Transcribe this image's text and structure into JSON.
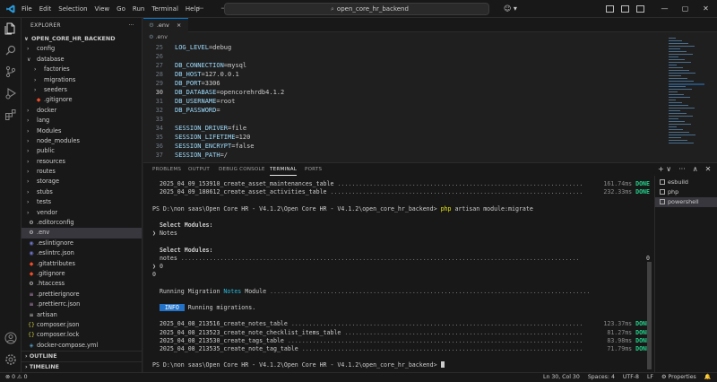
{
  "menu": [
    "File",
    "Edit",
    "Selection",
    "View",
    "Go",
    "Run",
    "Terminal",
    "Help"
  ],
  "title": {
    "nav_arrows": "← →",
    "search": "open_core_hr_backend",
    "search_icon": "search-icon"
  },
  "window_controls": [
    "—",
    "▢",
    "✕"
  ],
  "sidebar": {
    "header": "EXPLORER",
    "header_more": "···",
    "project": "OPEN_CORE_HR_BACKEND",
    "items": [
      {
        "label": "config",
        "type": "folder",
        "depth": 1,
        "expanded": false
      },
      {
        "label": "database",
        "type": "folder",
        "depth": 1,
        "expanded": true
      },
      {
        "label": "factories",
        "type": "folder",
        "depth": 2,
        "expanded": false
      },
      {
        "label": "migrations",
        "type": "folder",
        "depth": 2,
        "expanded": false
      },
      {
        "label": "seeders",
        "type": "folder",
        "depth": 2,
        "expanded": false
      },
      {
        "label": ".gitignore",
        "type": "file",
        "depth": 2,
        "icon": "◆",
        "color": "#f14c28"
      },
      {
        "label": "docker",
        "type": "folder",
        "depth": 1,
        "expanded": false
      },
      {
        "label": "lang",
        "type": "folder",
        "depth": 1,
        "expanded": false
      },
      {
        "label": "Modules",
        "type": "folder",
        "depth": 1,
        "expanded": false
      },
      {
        "label": "node_modules",
        "type": "folder",
        "depth": 1,
        "expanded": false
      },
      {
        "label": "public",
        "type": "folder",
        "depth": 1,
        "expanded": false
      },
      {
        "label": "resources",
        "type": "folder",
        "depth": 1,
        "expanded": false
      },
      {
        "label": "routes",
        "type": "folder",
        "depth": 1,
        "expanded": false
      },
      {
        "label": "storage",
        "type": "folder",
        "depth": 1,
        "expanded": false
      },
      {
        "label": "stubs",
        "type": "folder",
        "depth": 1,
        "expanded": false
      },
      {
        "label": "tests",
        "type": "folder",
        "depth": 1,
        "expanded": false
      },
      {
        "label": "vendor",
        "type": "folder",
        "depth": 1,
        "expanded": false
      },
      {
        "label": ".editorconfig",
        "type": "file",
        "depth": 1,
        "icon": "⚙",
        "color": "#cccccc"
      },
      {
        "label": ".env",
        "type": "file",
        "depth": 1,
        "icon": "⚙",
        "color": "#cccccc",
        "selected": true
      },
      {
        "label": ".eslintignore",
        "type": "file",
        "depth": 1,
        "icon": "◉",
        "color": "#6c71c4"
      },
      {
        "label": ".eslintrc.json",
        "type": "file",
        "depth": 1,
        "icon": "◉",
        "color": "#6c71c4"
      },
      {
        "label": ".gitattributes",
        "type": "file",
        "depth": 1,
        "icon": "◆",
        "color": "#f14c28"
      },
      {
        "label": ".gitignore",
        "type": "file",
        "depth": 1,
        "icon": "◆",
        "color": "#f14c28"
      },
      {
        "label": ".htaccess",
        "type": "file",
        "depth": 1,
        "icon": "⚙",
        "color": "#cccccc"
      },
      {
        "label": ".prettierignore",
        "type": "file",
        "depth": 1,
        "icon": "≡",
        "color": "#c596c7"
      },
      {
        "label": ".prettierrc.json",
        "type": "file",
        "depth": 1,
        "icon": "≡",
        "color": "#c596c7"
      },
      {
        "label": "artisan",
        "type": "file",
        "depth": 1,
        "icon": "≡",
        "color": "#cccccc"
      },
      {
        "label": "composer.json",
        "type": "file",
        "depth": 1,
        "icon": "{}",
        "color": "#cbcb41"
      },
      {
        "label": "composer.lock",
        "type": "file",
        "depth": 1,
        "icon": "{}",
        "color": "#cbcb41"
      },
      {
        "label": "docker-compose.yml",
        "type": "file",
        "depth": 1,
        "icon": "◈",
        "color": "#519aba"
      }
    ],
    "outline": "OUTLINE",
    "timeline": "TIMELINE"
  },
  "editor": {
    "tab_label": ".env",
    "tab_close": "×",
    "breadcrumb": ".env",
    "active_line": 30,
    "lines": [
      {
        "n": "25",
        "key": "LOG_LEVEL",
        "val": "debug"
      },
      {
        "n": "26",
        "key": "",
        "val": ""
      },
      {
        "n": "27",
        "key": "DB_CONNECTION",
        "val": "mysql"
      },
      {
        "n": "28",
        "key": "DB_HOST",
        "val": "127.0.0.1"
      },
      {
        "n": "29",
        "key": "DB_PORT",
        "val": "3306"
      },
      {
        "n": "30",
        "key": "DB_DATABASE",
        "val": "opencorehrdb4.1.2"
      },
      {
        "n": "31",
        "key": "DB_USERNAME",
        "val": "root"
      },
      {
        "n": "32",
        "key": "DB_PASSWORD",
        "val": ""
      },
      {
        "n": "33",
        "key": "",
        "val": ""
      },
      {
        "n": "34",
        "key": "SESSION_DRIVER",
        "val": "file"
      },
      {
        "n": "35",
        "key": "SESSION_LIFETIME",
        "val": "120"
      },
      {
        "n": "36",
        "key": "SESSION_ENCRYPT",
        "val": "false"
      },
      {
        "n": "37",
        "key": "SESSION_PATH",
        "val": "/"
      }
    ]
  },
  "panel": {
    "tabs": [
      "PROBLEMS",
      "OUTPUT",
      "DEBUG CONSOLE",
      "TERMINAL",
      "PORTS"
    ],
    "active_tab": "TERMINAL",
    "actions": [
      "+ ∨",
      "···",
      "∧",
      "✕"
    ],
    "terminals": [
      {
        "name": "esbuild",
        "active": false
      },
      {
        "name": "php",
        "active": false
      },
      {
        "name": "powershell",
        "active": true
      }
    ],
    "lines": [
      {
        "kind": "migr",
        "name": "2025_04_09_153910_create_asset_maintenances_table",
        "time": "161.74ms",
        "status": "DONE"
      },
      {
        "kind": "migr",
        "name": "2025_04_09_180612_create_asset_activities_table",
        "time": "232.33ms",
        "status": "DONE"
      },
      {
        "kind": "blank"
      },
      {
        "kind": "prompt",
        "prompt": "PS D:\\non saas\\Open Core HR - V4.1.2\\Open Core HR - V4.1.2\\open_core_hr_backend>",
        "cmd": "php",
        "args": " artisan module:migrate"
      },
      {
        "kind": "blank"
      },
      {
        "kind": "bold",
        "text": "  Select Modules:"
      },
      {
        "kind": "text",
        "text": "❯ Notes"
      },
      {
        "kind": "blank"
      },
      {
        "kind": "bold",
        "text": "  Select Modules:"
      },
      {
        "kind": "progress",
        "text": "  notes",
        "right": "0"
      },
      {
        "kind": "text",
        "text": "❯ 0"
      },
      {
        "kind": "text",
        "text": "0"
      },
      {
        "kind": "blank"
      },
      {
        "kind": "running",
        "pre": "  Running Migration ",
        "mod": "Notes",
        "post": " Module"
      },
      {
        "kind": "blank"
      },
      {
        "kind": "info",
        "badge": "INFO",
        "text": " Running migrations."
      },
      {
        "kind": "blank"
      },
      {
        "kind": "migr",
        "name": "2025_04_08_213516_create_notes_table",
        "time": "123.37ms",
        "status": "DONE"
      },
      {
        "kind": "migr",
        "name": "2025_04_08_213523_create_note_checklist_items_table",
        "time": "81.27ms",
        "status": "DONE"
      },
      {
        "kind": "migr",
        "name": "2025_04_08_213530_create_tags_table",
        "time": "83.98ms",
        "status": "DONE"
      },
      {
        "kind": "migr",
        "name": "2025_04_08_213535_create_note_tag_table",
        "time": "71.79ms",
        "status": "DONE"
      },
      {
        "kind": "blank"
      },
      {
        "kind": "prompt_cursor",
        "prompt": "PS D:\\non saas\\Open Core HR - V4.1.2\\Open Core HR - V4.1.2\\open_core_hr_backend>"
      }
    ]
  },
  "status": {
    "errors": "⊗ 0  ⚠ 0",
    "items": [
      "Ln 30, Col 30",
      "Spaces: 4",
      "UTF-8",
      "LF",
      "⚙ Properties",
      "🔔"
    ]
  }
}
